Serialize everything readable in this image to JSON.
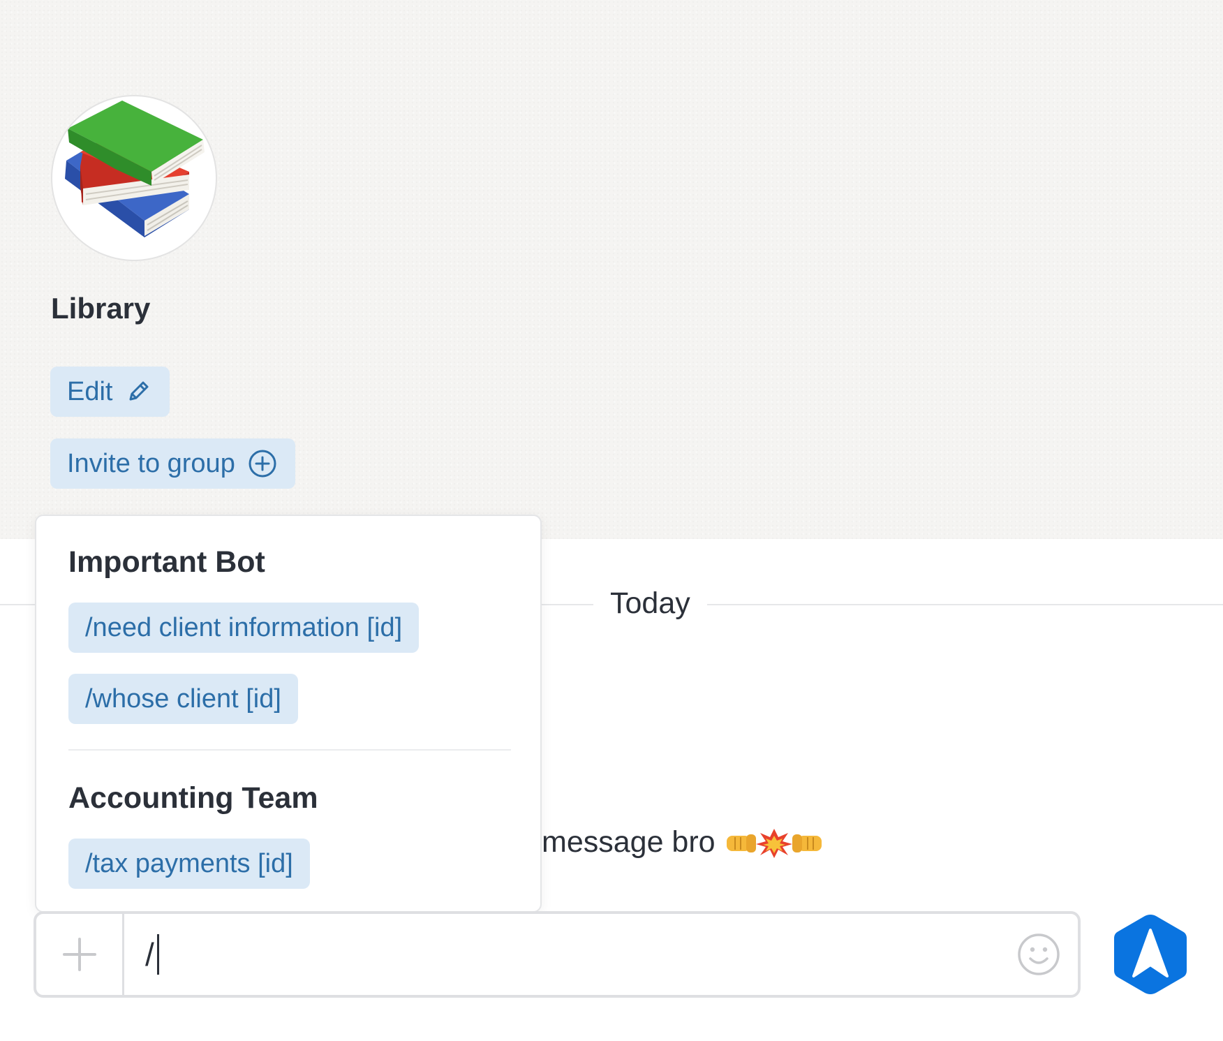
{
  "group": {
    "name": "Library",
    "avatar_icon": "books-icon"
  },
  "actions": {
    "edit_label": "Edit",
    "edit_icon": "pencil-icon",
    "invite_label": "Invite to group",
    "invite_icon": "plus-circle-icon"
  },
  "chat": {
    "day_label": "Today",
    "partial_message": "message bro",
    "message_emoji": [
      "left-facing-fist",
      "collision",
      "right-facing-fist"
    ]
  },
  "command_popup": {
    "sections": [
      {
        "title": "Important Bot",
        "commands": [
          "/need client information [id]",
          "/whose client [id]"
        ]
      },
      {
        "title": "Accounting Team",
        "commands": [
          "/tax payments [id]"
        ]
      }
    ]
  },
  "composer": {
    "value": "/",
    "attach_icon": "plus-icon",
    "emoji_icon": "smiley-icon",
    "send_icon": "send-arrow-icon"
  },
  "colors": {
    "accent": "#0a74e0",
    "pill_bg": "#dbe9f6",
    "pill_text": "#2c6ea8",
    "text": "#2b3039"
  }
}
